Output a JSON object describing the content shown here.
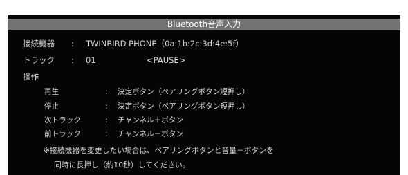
{
  "dialog": {
    "title": "Bluetooth音声入力"
  },
  "device_row": {
    "label": "接続機器",
    "separator": ":",
    "value": "TWINBIRD PHONE（0a:1b:2c:3d:4e:5f）"
  },
  "track_row": {
    "label": "トラック",
    "separator": ":",
    "track_number": "01",
    "status": "<PAUSE>"
  },
  "operations": {
    "heading": "操作",
    "items": [
      {
        "label": "再生",
        "separator": ":",
        "action": "決定ボタン（ペアリングボタン短押し）"
      },
      {
        "label": "停止",
        "separator": ":",
        "action": "決定ボタン（ペアリングボタン短押し）"
      },
      {
        "label": "次トラック",
        "separator": ":",
        "action": "チャンネル＋ボタン"
      },
      {
        "label": "前トラック",
        "separator": ":",
        "action": "チャンネル－ボタン"
      }
    ]
  },
  "note": {
    "line1": "※接続機器を変更したい場合は、ペアリングボタンと音量－ボタンを",
    "line2": "同時に長押し（約10秒）してください。"
  },
  "colors": {
    "background": "#050505",
    "title_bar": "#727272",
    "text": "#d8d8d8"
  }
}
